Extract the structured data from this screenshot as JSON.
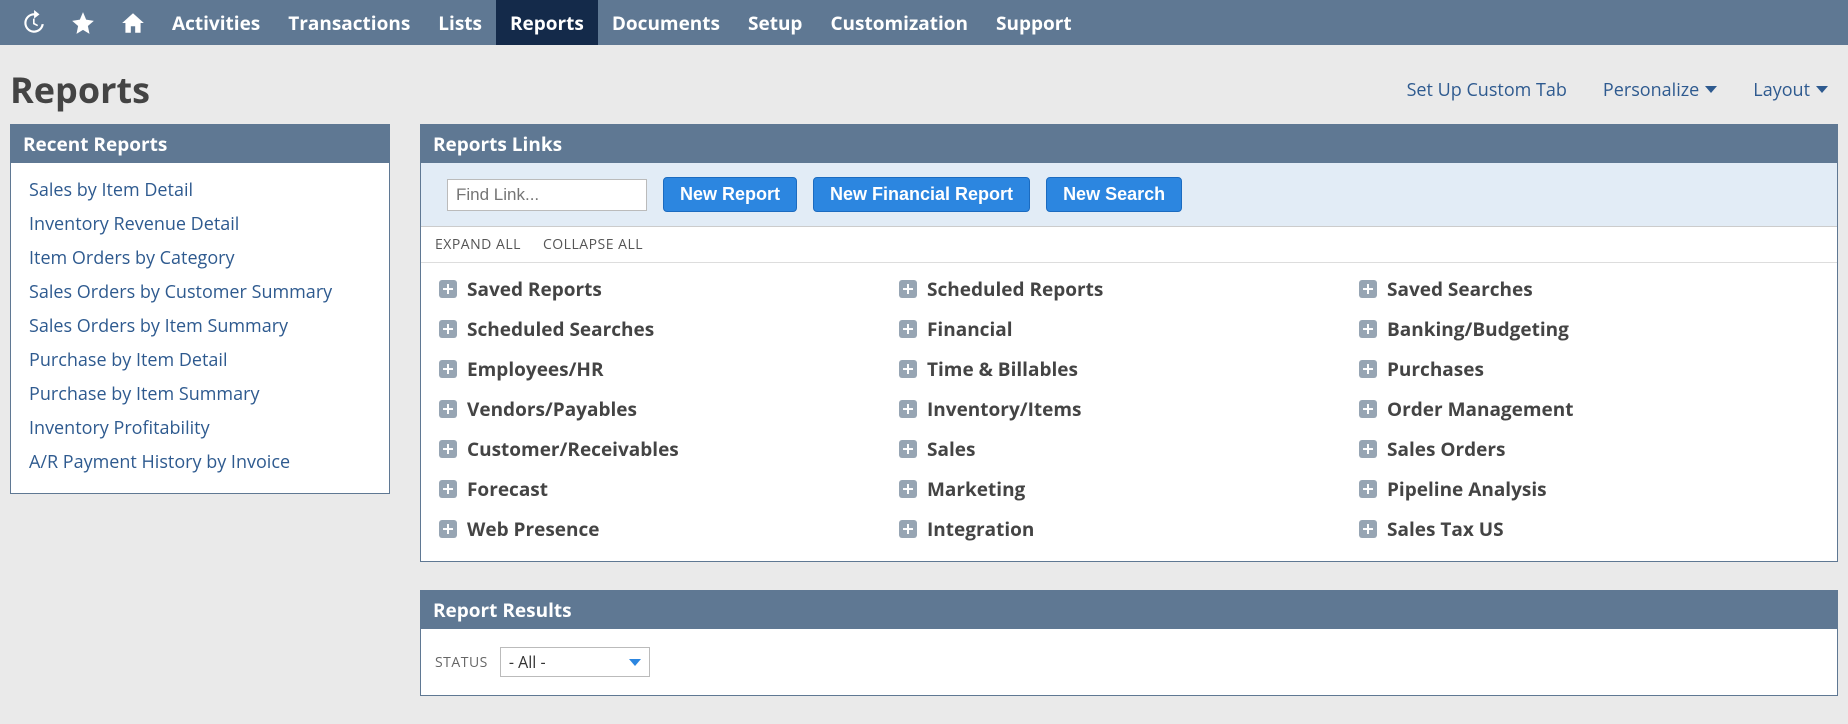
{
  "nav": {
    "items": [
      {
        "label": "Activities"
      },
      {
        "label": "Transactions"
      },
      {
        "label": "Lists"
      },
      {
        "label": "Reports",
        "active": true
      },
      {
        "label": "Documents"
      },
      {
        "label": "Setup"
      },
      {
        "label": "Customization"
      },
      {
        "label": "Support"
      }
    ]
  },
  "header": {
    "title": "Reports",
    "actions": {
      "setup_tab": "Set Up Custom Tab",
      "personalize": "Personalize",
      "layout": "Layout"
    }
  },
  "recent": {
    "title": "Recent Reports",
    "items": [
      "Sales by Item Detail",
      "Inventory Revenue Detail",
      "Item Orders by Category",
      "Sales Orders by Customer Summary",
      "Sales Orders by Item Summary",
      "Purchase by Item Detail",
      "Purchase by Item Summary",
      "Inventory Profitability",
      "A/R Payment History by Invoice"
    ]
  },
  "links": {
    "title": "Reports Links",
    "find_placeholder": "Find Link...",
    "buttons": {
      "new_report": "New Report",
      "new_financial": "New Financial Report",
      "new_search": "New Search"
    },
    "expand_all": "EXPAND ALL",
    "collapse_all": "COLLAPSE ALL",
    "categories": [
      "Saved Reports",
      "Scheduled Reports",
      "Saved Searches",
      "Scheduled Searches",
      "Financial",
      "Banking/Budgeting",
      "Employees/HR",
      "Time & Billables",
      "Purchases",
      "Vendors/Payables",
      "Inventory/Items",
      "Order Management",
      "Customer/Receivables",
      "Sales",
      "Sales Orders",
      "Forecast",
      "Marketing",
      "Pipeline Analysis",
      "Web Presence",
      "Integration",
      "Sales Tax US"
    ]
  },
  "results": {
    "title": "Report Results",
    "status_label": "STATUS",
    "status_value": "- All -"
  }
}
